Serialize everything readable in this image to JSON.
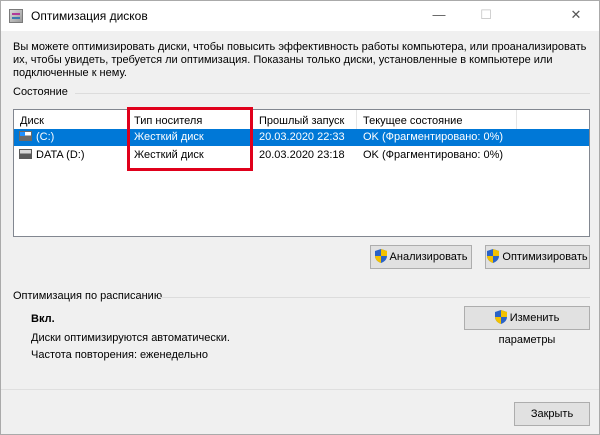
{
  "window": {
    "title": "Оптимизация дисков",
    "minimize_glyph": "—",
    "maximize_glyph": "☐",
    "close_glyph": "✕"
  },
  "intro": {
    "line1": "Вы можете оптимизировать диски, чтобы повысить эффективность работы  компьютера, или проанализировать",
    "line2": "их, чтобы увидеть, требуется ли оптимизация. Показаны только диски, установленные в компьютере или",
    "line3": "подключенные к нему."
  },
  "status_group": {
    "label": "Состояние",
    "columns": {
      "disk": "Диск",
      "media_type": "Тип носителя",
      "last_run": "Прошлый запуск",
      "current_state": "Текущее состояние"
    },
    "rows": [
      {
        "disk": "(C:)",
        "media_type": "Жесткий диск",
        "last_run": "20.03.2020 22:33",
        "current_state": "OK (Фрагментировано: 0%)",
        "icon": "system-drive-icon",
        "selected": true
      },
      {
        "disk": "DATA (D:)",
        "media_type": "Жесткий диск",
        "last_run": "20.03.2020 23:18",
        "current_state": "OK (Фрагментировано: 0%)",
        "icon": "hard-drive-icon",
        "selected": false
      }
    ]
  },
  "actions": {
    "analyze_label": "Анализировать",
    "optimize_label": "Оптимизировать"
  },
  "schedule": {
    "label": "Оптимизация по расписанию",
    "state": "Вкл.",
    "description": "Диски оптимизируются автоматически.",
    "frequency": "Частота повторения: еженедельно",
    "change_settings_label": "Изменить параметры"
  },
  "footer": {
    "close_label": "Закрыть"
  },
  "colors": {
    "selection": "#0078d7",
    "highlight_box": "#e0001b",
    "window_bg": "#f0f0f0"
  }
}
